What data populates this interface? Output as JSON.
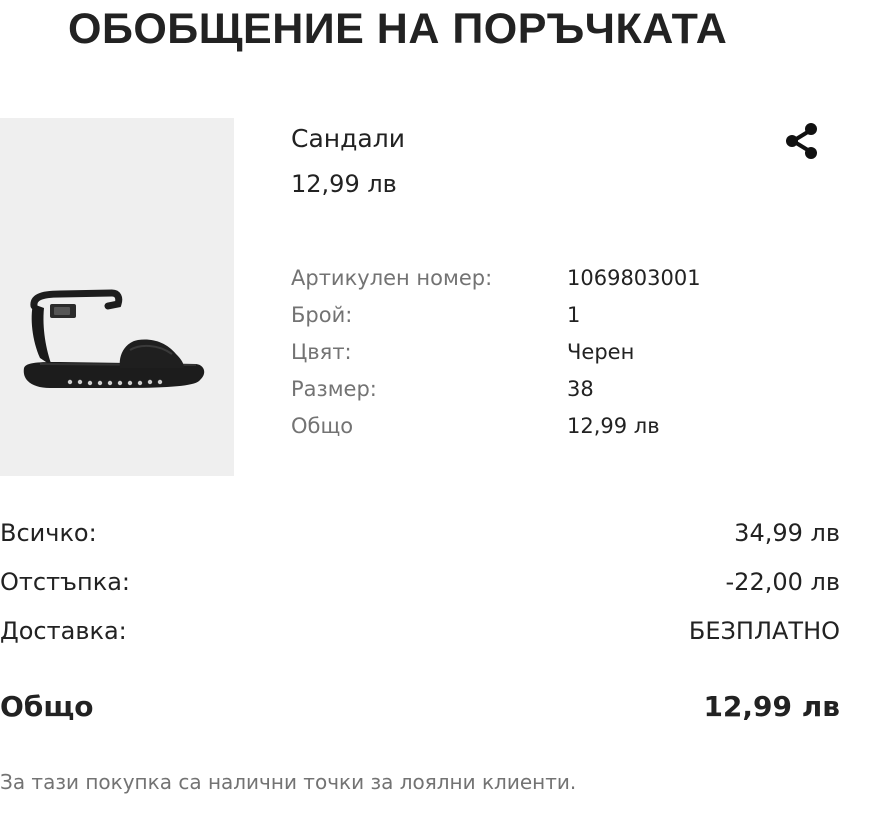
{
  "header": {
    "title": "ОБОБЩЕНИЕ НА ПОРЪЧКАТА"
  },
  "product": {
    "name": "Сандали",
    "price": "12,99 лв",
    "image_icon": "sandal-image",
    "share_icon": "share-icon",
    "details": [
      {
        "label": "Артикулен номер:",
        "value": "1069803001"
      },
      {
        "label": "Брой:",
        "value": "1"
      },
      {
        "label": "Цвят:",
        "value": "Черен"
      },
      {
        "label": "Размер:",
        "value": "38"
      },
      {
        "label": "Общо",
        "value": "12,99 лв"
      }
    ]
  },
  "summary": {
    "rows": [
      {
        "label": "Всичко:",
        "value": "34,99 лв"
      },
      {
        "label": "Отстъпка:",
        "value": "-22,00 лв"
      },
      {
        "label": "Доставка:",
        "value": "БЕЗПЛАТНО"
      }
    ],
    "total": {
      "label": "Общо",
      "value": "12,99 лв"
    }
  },
  "loyalty_note": "За тази покупка са налични точки за лоялни клиенти.",
  "colors": {
    "text": "#222222",
    "muted": "#737373",
    "image_bg": "#efefef"
  }
}
